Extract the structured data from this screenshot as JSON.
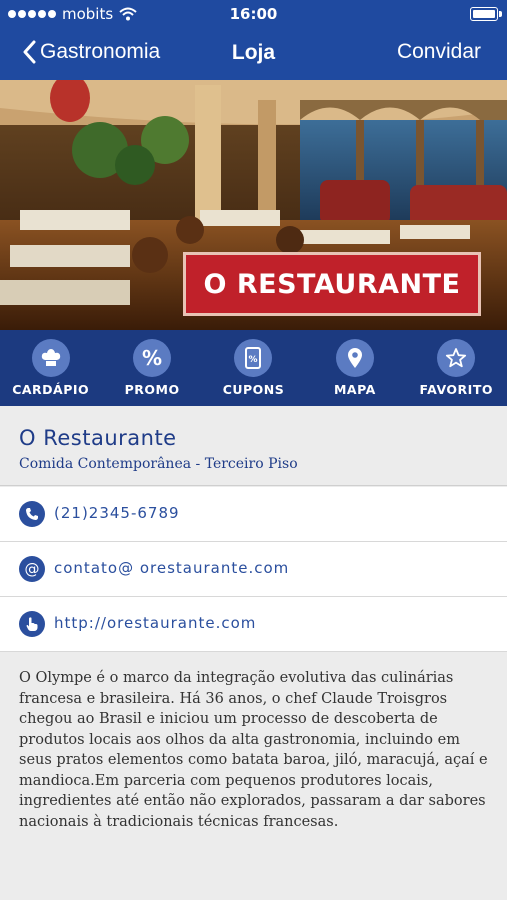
{
  "status_bar": {
    "carrier": "mobits",
    "time": "16:00",
    "icons": [
      "signal-dots",
      "wifi-icon",
      "battery-icon"
    ]
  },
  "nav": {
    "back_label": "Gastronomia",
    "title": "Loja",
    "right_label": "Convidar"
  },
  "hero": {
    "badge_text": "O RESTAURANTE"
  },
  "tabs": [
    {
      "label": "CARDÁPIO",
      "icon": "chef-hat-icon"
    },
    {
      "label": "PROMO",
      "icon": "percent-icon"
    },
    {
      "label": "CUPONS",
      "icon": "coupon-icon"
    },
    {
      "label": "MAPA",
      "icon": "map-pin-icon"
    },
    {
      "label": "FAVORITO",
      "icon": "star-icon"
    }
  ],
  "store": {
    "name": "O Restaurante",
    "subtitle": "Comida Contemporânea - Terceiro Piso"
  },
  "contacts": {
    "phone": "(21)2345-6789",
    "email": "contato@ orestaurante.com",
    "website": "http://orestaurante.com"
  },
  "description": "O Olympe é o marco da integração evolutiva das culinárias francesa e brasileira. Há 36 anos, o chef Claude Troisgros chegou ao Brasil e iniciou um processo de descoberta de produtos locais aos olhos da alta gastronomia, incluindo em seus pratos elementos como batata baroa, jiló, maracujá, açaí e mandioca.Em parceria com pequenos produtores locais, ingredientes até então não explorados, passaram a dar sabores nacionais à tradicionais técnicas francesas.",
  "colors": {
    "nav_blue": "#1f4aa0",
    "tab_blue": "#1c3a80",
    "badge_red": "#c0212a",
    "text_blue": "#1f3c88"
  }
}
